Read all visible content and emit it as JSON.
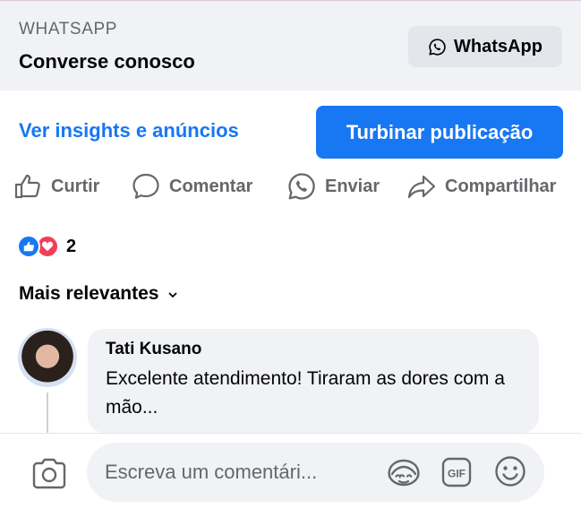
{
  "whatsapp_card": {
    "overline": "WHATSAPP",
    "title": "Converse conosco",
    "button_label": "WhatsApp"
  },
  "post_actions": {
    "insights_link": "Ver insights e anúncios",
    "boost_label": "Turbinar publicação"
  },
  "action_bar": {
    "like": "Curtir",
    "comment": "Comentar",
    "send": "Enviar",
    "share": "Compartilhar"
  },
  "reactions": {
    "types": [
      "like-icon",
      "love-icon"
    ],
    "count": "2"
  },
  "comments": {
    "sort_label": "Mais relevantes",
    "items": [
      {
        "author": "Tati Kusano",
        "text": "Excelente atendimento! Tiraram as dores com a mão..."
      }
    ]
  },
  "composer": {
    "placeholder": "Escreva um comentári..."
  },
  "colors": {
    "accent": "#1877f2",
    "surface": "#f0f2f5",
    "secondary_text": "#65676b",
    "love": "#f33e58"
  },
  "icons": [
    "whatsapp-icon",
    "like-outline-icon",
    "comment-icon",
    "whatsapp-send-icon",
    "share-icon",
    "chevron-down-icon",
    "camera-icon",
    "avatar-sticker-icon",
    "gif-icon",
    "emoji-icon"
  ]
}
